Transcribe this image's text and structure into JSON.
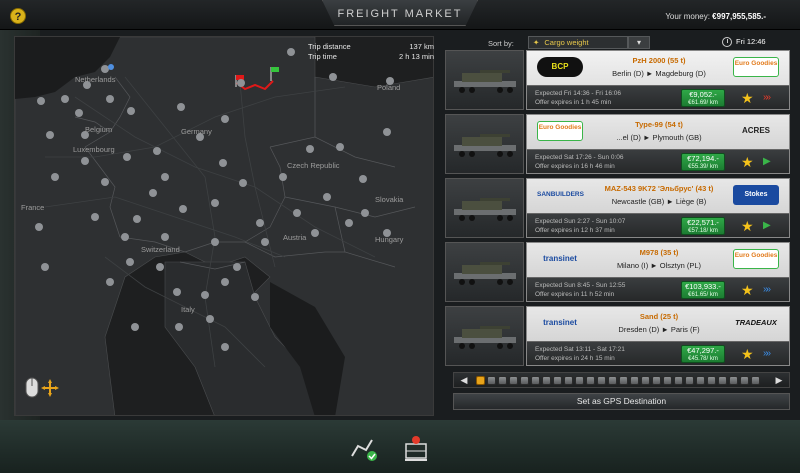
{
  "header": {
    "title": "FREIGHT MARKET",
    "help_glyph": "?",
    "money_label": "Your money:",
    "money_value": "€997,955,585.-"
  },
  "map": {
    "trip_distance_label": "Trip distance",
    "trip_distance_value": "137 km",
    "trip_time_label": "Trip time",
    "trip_time_value": "2 h 13 min",
    "labels": {
      "netherlands": "Netherlands",
      "belgium": "Belgium",
      "luxembourg": "Luxembourg",
      "france": "France",
      "germany": "Germany",
      "poland": "Poland",
      "czech": "Czech Republic",
      "slovakia": "Slovakia",
      "switzerland": "Switzerland",
      "austria": "Austria",
      "hungary": "Hungary",
      "italy": "Italy"
    }
  },
  "sort": {
    "label": "Sort by:",
    "value": "Cargo weight",
    "time": "Fri 12:46"
  },
  "jobs": [
    {
      "cargo": "PzH 2000 (55 t)",
      "route": "Berlin (D)  ►  Magdeburg (D)",
      "expected": "Expected Fri 14:36 - Fri 16:06",
      "expires": "Offer expires in  1 h 45 min",
      "price": "€9,052.-",
      "per_km": "€61.69/ km",
      "logo_left": "BCP",
      "logo_right": "Euro Goodies",
      "urgency_glyph": "»»",
      "urgency_color": "#e23a2a"
    },
    {
      "cargo": "Type-99 (54 t)",
      "route": "...el (D)  ►  Plymouth (GB)",
      "expected": "Expected Sat 17:26 - Sun 0:06",
      "expires": "Offer expires in  16 h 46 min",
      "price": "€72,194.-",
      "per_km": "€55.39/ km",
      "logo_left": "Euro Goodies",
      "logo_right": "ACRES",
      "urgency_glyph": "▶",
      "urgency_color": "#3ab549"
    },
    {
      "cargo": "MAZ-543 9K72 'Эльбрус' (43 t)",
      "route": "Newcastle (GB)  ►  Liège (B)",
      "expected": "Expected Sun 2:27 - Sun 10:07",
      "expires": "Offer expires in  12 h 37 min",
      "price": "€22,571.-",
      "per_km": "€57.18/ km",
      "logo_left": "SANBUILDERS",
      "logo_right": "Stokes",
      "urgency_glyph": "▶",
      "urgency_color": "#3ab549"
    },
    {
      "cargo": "M978 (35 t)",
      "route": "Milano (I)  ►  Olsztyn (PL)",
      "expected": "Expected Sun 8:45 - Sun 12:55",
      "expires": "Offer expires in  11 h 52 min",
      "price": "€103,933.-",
      "per_km": "€61.65/ km",
      "logo_left": "transinet",
      "logo_right": "Euro Goodies",
      "urgency_glyph": "»»",
      "urgency_color": "#3a8ae2"
    },
    {
      "cargo": "Sand (25 t)",
      "route": "Dresden (D)  ►  Paris (F)",
      "expected": "Expected Sat 13:11 - Sat 17:21",
      "expires": "Offer expires in  24 h 15 min",
      "price": "€47,297.-",
      "per_km": "€45.78/ km",
      "logo_left": "transinet",
      "logo_right": "TRADEAUX",
      "urgency_glyph": "»»",
      "urgency_color": "#3a8ae2"
    }
  ],
  "timeline": {
    "prev_glyph": "◀",
    "next_glyph": "▶"
  },
  "gps_button": "Set as GPS Destination",
  "colors": {
    "cargo_orange": "#c76a00",
    "price_green": "#2fa847",
    "star_yellow": "#f4c21b"
  }
}
